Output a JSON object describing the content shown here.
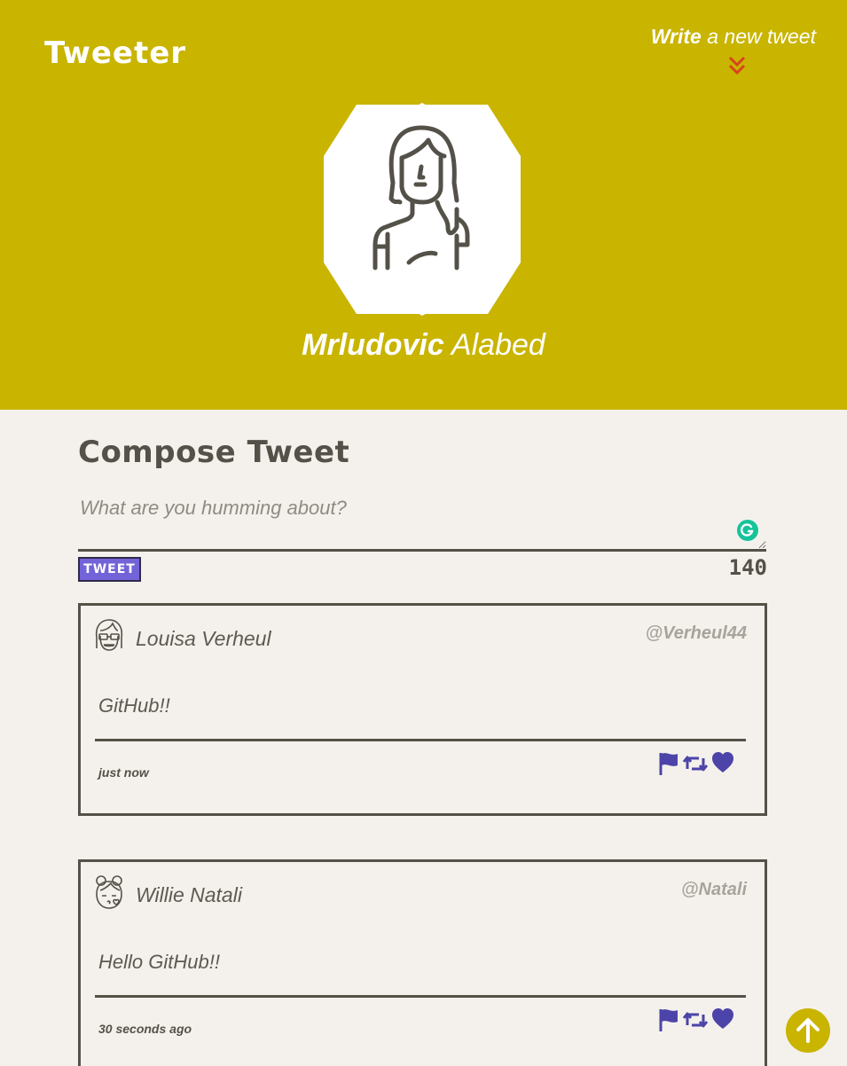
{
  "header": {
    "brand": "Tweeter",
    "write_strong": "Write",
    "write_rest": " a new tweet",
    "profile_first": "Mrludovic",
    "profile_last": " Alabed"
  },
  "compose": {
    "title": "Compose Tweet",
    "placeholder": "What are you humming about?",
    "button": "TWEET",
    "counter": "140"
  },
  "tweets": [
    {
      "name": "Louisa Verheul",
      "handle": "@Verheul44",
      "text": "GitHub!!",
      "time": "just now"
    },
    {
      "name": "Willie Natali",
      "handle": "@Natali",
      "text": "Hello GitHub!!",
      "time": "30 seconds ago"
    }
  ],
  "colors": {
    "header_bg": "#c9b400",
    "page_bg": "#f4f1ec",
    "text_dark": "#545149",
    "accent_purple": "#7363d8",
    "icon_purple": "#4c44a8",
    "chevron_red": "#d9441c"
  },
  "icons": {
    "flag": "flag-icon",
    "retweet": "retweet-icon",
    "like": "heart-icon",
    "write_toggle": "chevron-double-down-icon",
    "scroll_top": "arrow-up-icon"
  }
}
